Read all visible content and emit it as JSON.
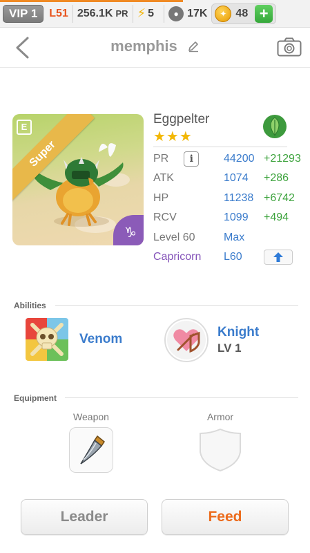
{
  "topbar": {
    "vip": "VIP 1",
    "level": "L51",
    "pr_value": "256.1K",
    "pr_unit": "PR",
    "energy": "5",
    "food": "17K",
    "coins": "48",
    "add": "+"
  },
  "header": {
    "title": "memphis"
  },
  "monster": {
    "rarity": "Super",
    "tag": "E",
    "sign_glyph": "♑",
    "name": "Eggpelter",
    "stars": "★★★",
    "stats": [
      {
        "label": "PR",
        "value": "44200",
        "bonus": "+21293"
      },
      {
        "label": "ATK",
        "value": "1074",
        "bonus": "+286"
      },
      {
        "label": "HP",
        "value": "11238",
        "bonus": "+6742"
      },
      {
        "label": "RCV",
        "value": "1099",
        "bonus": "+494"
      }
    ],
    "level_label": "Level 60",
    "level_value": "Max",
    "sign_label": "Capricorn",
    "sign_value": "L60",
    "info_glyph": "i"
  },
  "abilities": {
    "title": "Abilities",
    "items": [
      {
        "name": "Venom"
      },
      {
        "name": "Knight",
        "level": "LV 1"
      }
    ]
  },
  "equipment": {
    "title": "Equipment",
    "weapon_label": "Weapon",
    "armor_label": "Armor"
  },
  "actions": {
    "leader": "Leader",
    "feed": "Feed"
  },
  "colors": {
    "accent_blue": "#3b7ccc",
    "bonus_green": "#3da33d",
    "feed_orange": "#ec6b1c",
    "capricorn_purple": "#8453b9",
    "level_orange": "#e8541e"
  }
}
